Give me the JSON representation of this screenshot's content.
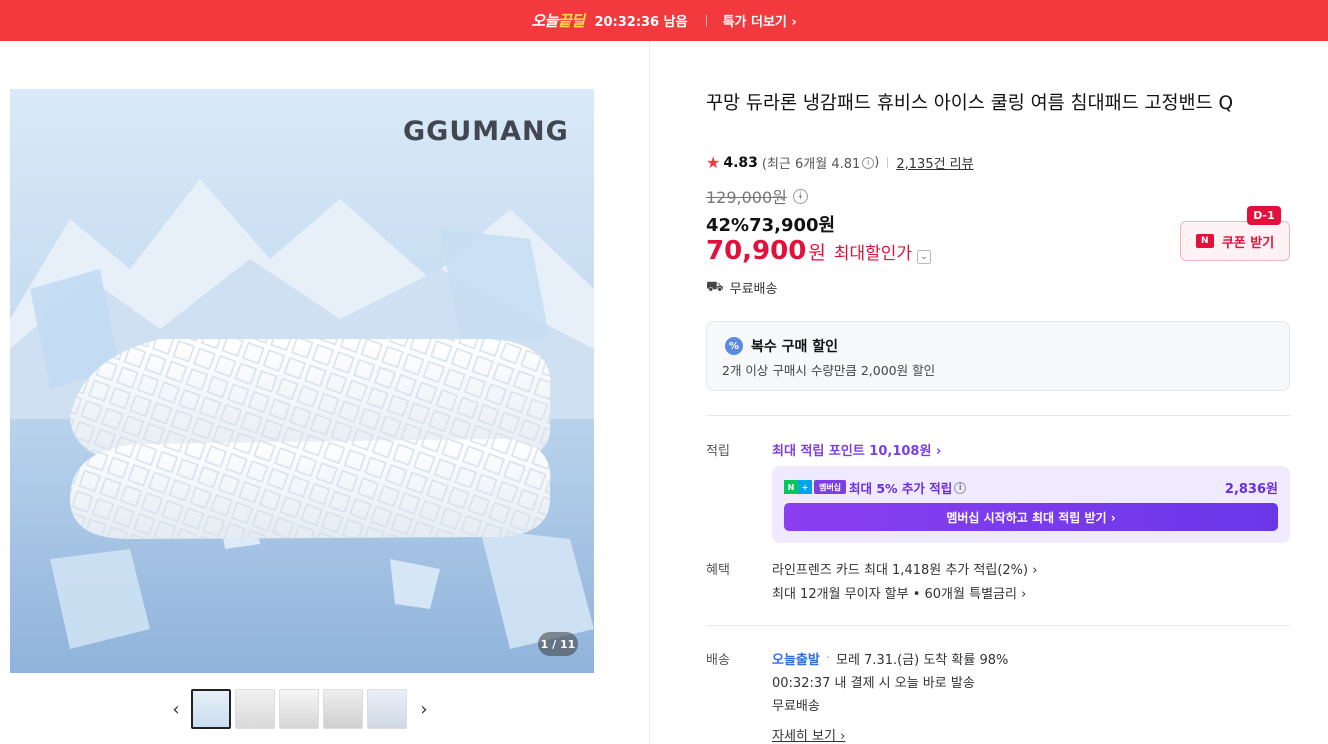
{
  "banner": {
    "logo_part1": "오늘",
    "logo_part2": "끝딜",
    "countdown": "20:32:36 남음",
    "more_label": "특가 더보기 ›"
  },
  "gallery": {
    "brand_text": "GGUMANG",
    "counter": "1 / 11",
    "prev_arrow": "‹",
    "next_arrow": "›"
  },
  "product": {
    "title": "꾸망 듀라론 냉감패드 휴비스 아이스 쿨링 여름 침대패드 고정밴드 Q",
    "rating": "4.83",
    "rating_recent": "(최근 6개월 4.81",
    "rating_recent_close": ")",
    "reviews": "2,135건 리뷰",
    "original_price": "129,000원",
    "discount_line": "42%73,900원",
    "final_price": "70,900",
    "final_won": "원",
    "final_label": "최대할인가",
    "shipping": "무료배송",
    "coupon_label": "쿠폰 받기",
    "coupon_badge": "D-1",
    "coupon_logo": "N"
  },
  "multi_discount": {
    "icon": "%",
    "title": "복수 구매 할인",
    "desc": "2개 이상 구매시 수량만큼 2,000원 할인"
  },
  "points": {
    "label": "적립",
    "max_points": "최대 적립 포인트 10,108원 ›",
    "membership_logo_n": "N",
    "membership_logo_plus": "+",
    "membership_logo_text": "멤버십",
    "extra": "최대 5% 추가 적립",
    "extra_amount": "2,836원",
    "button": "멤버십 시작하고 최대 적립 받기 ›"
  },
  "benefits": {
    "label": "혜택",
    "line1": "라인프렌즈 카드 최대 1,418원 추가 적립(2%) ›",
    "line2": "최대 12개월 무이자 할부 • 60개월 특별금리 ›"
  },
  "delivery": {
    "label": "배송",
    "badge": "오늘출발",
    "arrival": "모레 7.31.(금) 도착 확률 98%",
    "cutoff": "00:32:37  내 결제 시 오늘 바로 발송",
    "fee": "무료배송",
    "detail": "자세히 보기 ›"
  },
  "colors": {
    "banner_red": "#f2393e",
    "price_red": "#e3103b",
    "purple": "#7b3fe4",
    "blue": "#2f6fe0"
  }
}
